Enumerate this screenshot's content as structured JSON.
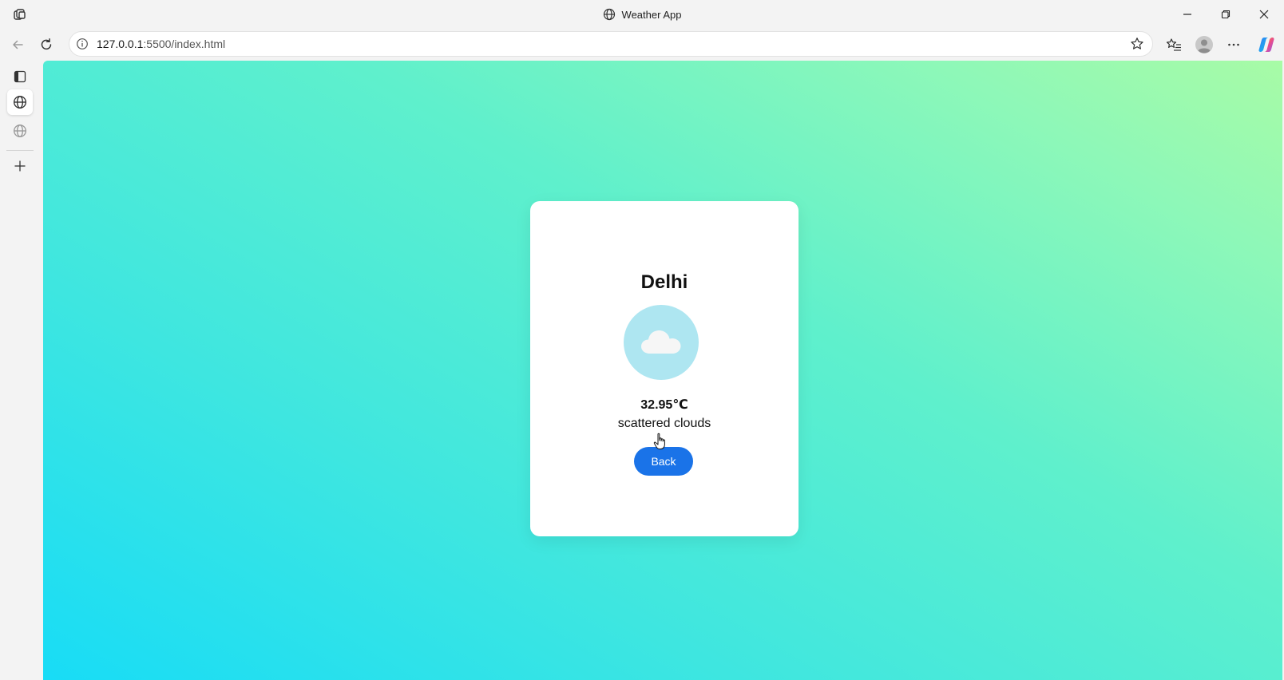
{
  "window": {
    "title": "Weather App"
  },
  "browser": {
    "url_host": "127.0.0.1",
    "url_rest": ":5500/index.html"
  },
  "icons": {
    "workspaces": "workspaces-icon",
    "globe": "globe-icon",
    "minimize": "minimize-icon",
    "restore": "restore-icon",
    "close": "close-icon",
    "back": "back-arrow-icon",
    "refresh": "refresh-icon",
    "info": "info-icon",
    "favorite": "star-icon",
    "favorites": "favorites-icon",
    "profile": "profile-icon",
    "more": "more-icon",
    "copilot": "copilot-icon",
    "sidebar": "sidebar-toggle-icon",
    "add": "plus-icon",
    "weather": "cloud-icon",
    "cursor": "hand-pointer-icon"
  },
  "weather": {
    "city": "Delhi",
    "temperature": "32.95℃",
    "description": "scattered clouds",
    "back_label": "Back"
  },
  "colors": {
    "button": "#1a73e8",
    "icon_bg": "#aee6f1",
    "gradient_start": "#18dcf6",
    "gradient_end": "#a8fba6"
  }
}
